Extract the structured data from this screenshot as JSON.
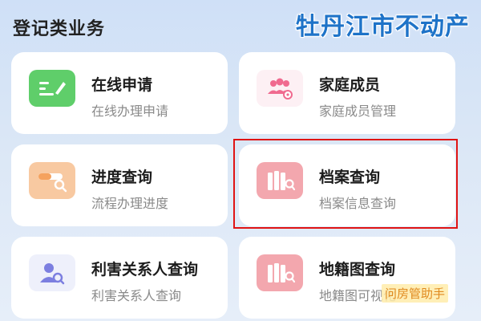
{
  "section_title": "登记类业务",
  "brand": "牡丹江市不动产",
  "cards": [
    {
      "title": "在线申请",
      "subtitle": "在线办理申请",
      "icon": "edit-document-icon",
      "color": "#5fce6a"
    },
    {
      "title": "家庭成员",
      "subtitle": "家庭成员管理",
      "icon": "family-members-icon",
      "color": "#f06a8f"
    },
    {
      "title": "进度查询",
      "subtitle": "流程办理进度",
      "icon": "progress-search-icon",
      "color": "#f5b27a"
    },
    {
      "title": "档案查询",
      "subtitle": "档案信息查询",
      "icon": "archive-search-icon",
      "color": "#f09aa3"
    },
    {
      "title": "利害关系人查询",
      "subtitle": "利害关系人查询",
      "icon": "person-search-icon",
      "color": "#7c7fe0"
    },
    {
      "title": "地籍图查询",
      "subtitle": "地籍图可视化",
      "icon": "cadastral-map-icon",
      "color": "#f09aa3"
    }
  ],
  "watermark": "问房管助手"
}
